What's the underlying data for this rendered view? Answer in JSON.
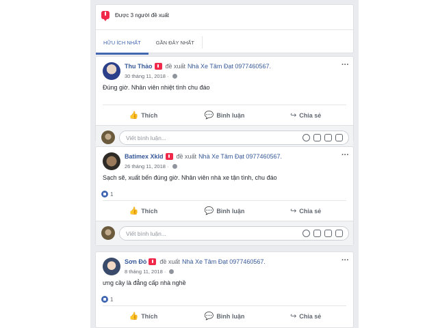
{
  "recommend_header": {
    "text": "Được 3 người đề xuất",
    "tabs": [
      {
        "label": "HỮU ÍCH NHẤT",
        "active": true
      },
      {
        "label": "GẦN ĐÂY NHẤT",
        "active": false
      }
    ]
  },
  "posts": [
    {
      "author": "Thu Thảo",
      "verb": "đề xuất",
      "page": "Nhà Xe Tâm Đạt 0977460567.",
      "date": "30 tháng 11, 2018 ·",
      "body": "Đúng giờ. Nhân viên nhiệt tình chu đáo",
      "likes": ""
    },
    {
      "author": "Batimex Xkld",
      "verb": "đề xuất",
      "page": "Nhà Xe Tâm Đạt 0977460567.",
      "date": "26 tháng 11, 2018 ·",
      "body": "Sạch sẽ, xuất bến đúng giờ. Nhân viên nhà xe tận tình, chu đáo",
      "likes": "1"
    },
    {
      "author": "Sơn Đỏ",
      "verb": "đề xuất",
      "page": "Nhà Xe Tâm Đạt 0977460567.",
      "date": "8 tháng 11, 2018 ·",
      "body": "ưng cầy là đẳng cấp nhà nghề",
      "likes": "1"
    }
  ],
  "actions": {
    "like": "Thích",
    "comment": "Bình luận",
    "share": "Chia sẻ"
  },
  "comment_placeholder": "Viết bình luận...",
  "more_label": "···"
}
